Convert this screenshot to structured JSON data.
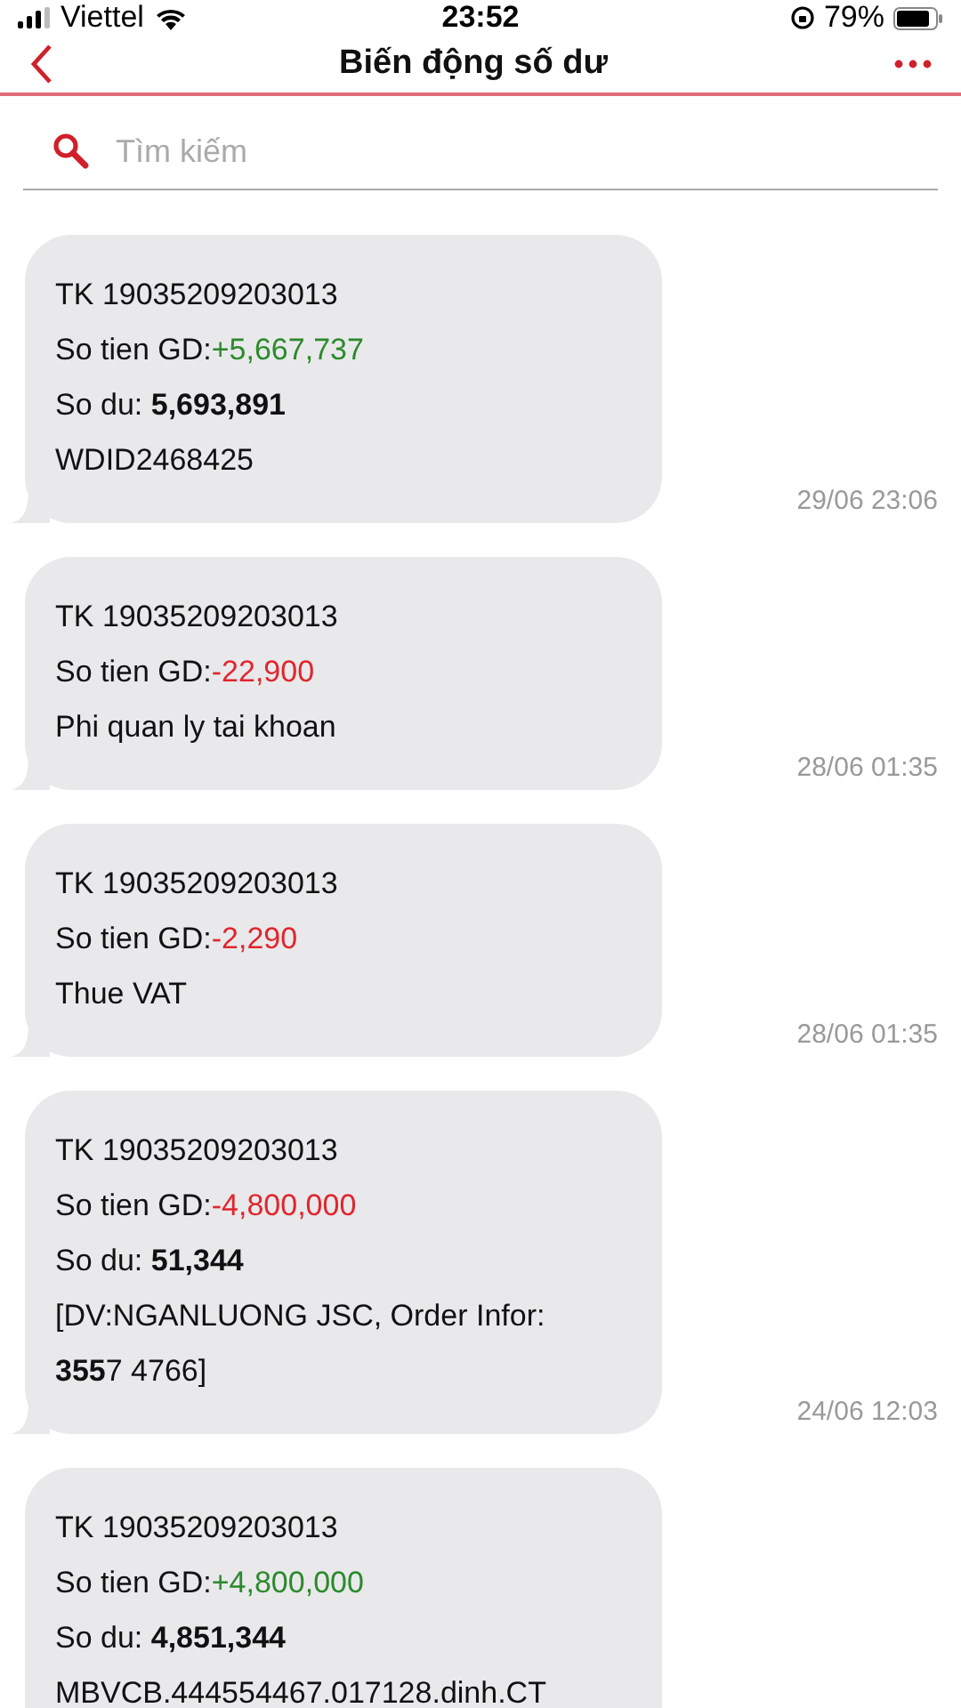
{
  "status_bar": {
    "carrier": "Viettel",
    "time": "23:52",
    "battery": "79%"
  },
  "header": {
    "title": "Biến động số dư"
  },
  "search": {
    "placeholder": "Tìm kiếm"
  },
  "messages": [
    {
      "lines": [
        {
          "kind": "text",
          "text": "TK 19035209203013"
        },
        {
          "kind": "amount",
          "label": "So tien GD:",
          "value": "+5,667,737",
          "color": "#2c8a2c"
        },
        {
          "kind": "text",
          "text": "So du: **5,693,891**"
        },
        {
          "kind": "text",
          "text": "WDID2468425"
        }
      ],
      "time": "29/06 23:06"
    },
    {
      "lines": [
        {
          "kind": "text",
          "text": "TK 19035209203013"
        },
        {
          "kind": "amount",
          "label": "So tien GD:",
          "value": "-22,900",
          "color": "#e0262e"
        },
        {
          "kind": "text",
          "text": "Phi quan ly tai khoan"
        }
      ],
      "time": "28/06 01:35"
    },
    {
      "lines": [
        {
          "kind": "text",
          "text": "TK 19035209203013"
        },
        {
          "kind": "amount",
          "label": "So tien GD:",
          "value": "-2,290",
          "color": "#e0262e"
        },
        {
          "kind": "text",
          "text": "Thue VAT"
        }
      ],
      "time": "28/06 01:35"
    },
    {
      "lines": [
        {
          "kind": "text",
          "text": "TK 19035209203013"
        },
        {
          "kind": "amount",
          "label": "So tien GD:",
          "value": "-4,800,000",
          "color": "#e0262e"
        },
        {
          "kind": "text",
          "text": "So du: **51,344**"
        },
        {
          "kind": "text",
          "text": "[DV:NGANLUONG JSC, Order Infor:"
        },
        {
          "kind": "text",
          "text": "**355**7 4766]"
        }
      ],
      "time": "24/06 12:03"
    },
    {
      "lines": [
        {
          "kind": "text",
          "text": "TK 19035209203013"
        },
        {
          "kind": "amount",
          "label": "So tien GD:",
          "value": "+4,800,000",
          "color": "#2c8a2c"
        },
        {
          "kind": "text",
          "text": "So du: **4,851,344**"
        },
        {
          "kind": "text",
          "text": "MBVCB.444554467.017128.dinh.CT"
        }
      ]
    }
  ]
}
